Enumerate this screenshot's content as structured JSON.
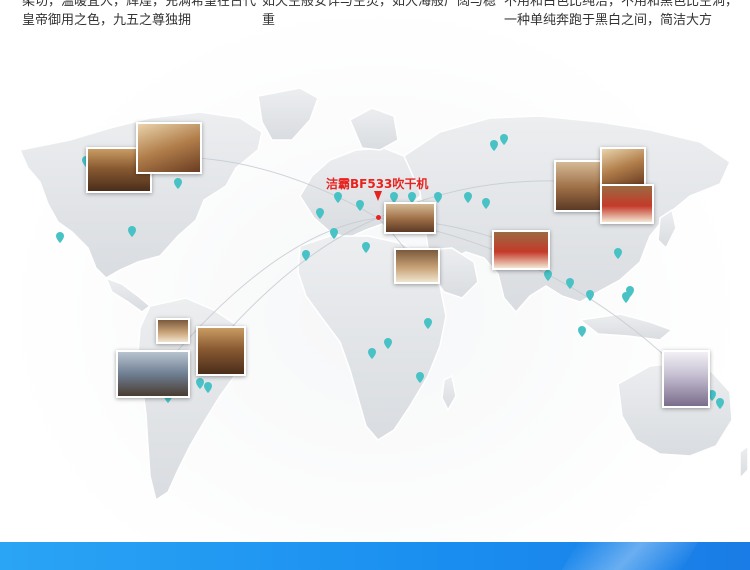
{
  "header": {
    "col1": [
      "柔切，温暖宜人，辉煌，充满希望在古代",
      "皇帝御用之色，九五之尊独拥"
    ],
    "col2": [
      "如天空般安详与空灵，如大海般广阔与稳",
      "重"
    ],
    "col3": [
      "不用和白色比纯洁，不用和黑色比空洞，",
      "一种单纯奔跑于黑白之间，简洁大方"
    ]
  },
  "map": {
    "product_label": "洁霸BF533吹干机",
    "land_color": "#e3e5e8",
    "pin_color": "#49c2c6",
    "highlight_color": "#e8231f"
  },
  "photos": [
    "hotel-photo-north-america",
    "hotel-photo-europe",
    "hotel-photo-middle-east",
    "hotel-photo-india",
    "hotel-photo-east-asia",
    "hotel-photo-south-america",
    "hotel-photo-australia"
  ]
}
